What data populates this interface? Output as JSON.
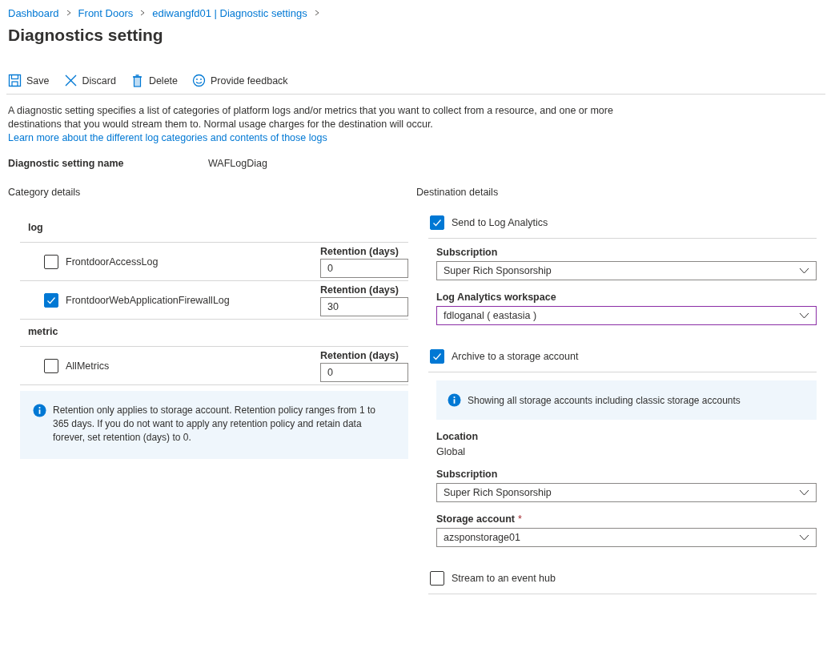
{
  "breadcrumb": [
    "Dashboard",
    "Front Doors",
    "ediwangfd01 | Diagnostic settings"
  ],
  "title": "Diagnostics setting",
  "toolbar": [
    {
      "kind": "save",
      "label": "Save"
    },
    {
      "kind": "discard",
      "label": "Discard"
    },
    {
      "kind": "delete",
      "label": "Delete"
    },
    {
      "kind": "feedback",
      "label": "Provide feedback"
    }
  ],
  "description": {
    "text": "A diagnostic setting specifies a list of categories of platform logs and/or metrics that you want to collect from a resource, and one or more destinations that you would stream them to. Normal usage charges for the destination will occur.",
    "link": "Learn more about the different log categories and contents of those logs"
  },
  "setting_name": {
    "label": "Diagnostic setting name",
    "value": "WAFLogDiag"
  },
  "category_details": {
    "heading": "Category details",
    "groups": [
      {
        "name": "log",
        "items": [
          {
            "name": "FrontdoorAccessLog",
            "checked": false,
            "retention_label": "Retention (days)",
            "retention": "0"
          },
          {
            "name": "FrontdoorWebApplicationFirewallLog",
            "checked": true,
            "retention_label": "Retention (days)",
            "retention": "30"
          }
        ]
      },
      {
        "name": "metric",
        "items": [
          {
            "name": "AllMetrics",
            "checked": false,
            "retention_label": "Retention (days)",
            "retention": "0"
          }
        ]
      }
    ],
    "info": "Retention only applies to storage account. Retention policy ranges from 1 to 365 days. If you do not want to apply any retention policy and retain data forever, set retention (days) to 0."
  },
  "destination_details": {
    "heading": "Destination details",
    "destinations": [
      {
        "label": "Send to Log Analytics",
        "checked": true,
        "items": [
          {
            "kind": "dropdown",
            "label": "Subscription",
            "value": "Super Rich Sponsorship",
            "focused": false
          },
          {
            "kind": "dropdown",
            "label": "Log Analytics workspace",
            "value": "fdloganal ( eastasia )",
            "focused": true
          }
        ]
      },
      {
        "label": "Archive to a storage account",
        "checked": true,
        "items": [
          {
            "kind": "info",
            "text": "Showing all storage accounts including classic storage accounts"
          },
          {
            "kind": "static",
            "label": "Location",
            "value": "Global"
          },
          {
            "kind": "dropdown",
            "label": "Subscription",
            "value": "Super Rich Sponsorship",
            "focused": false
          },
          {
            "kind": "dropdown",
            "label": "Storage account",
            "required_mark": "*",
            "value": "azsponstorage01",
            "focused": false
          }
        ]
      },
      {
        "label": "Stream to an event hub",
        "checked": false
      }
    ]
  }
}
